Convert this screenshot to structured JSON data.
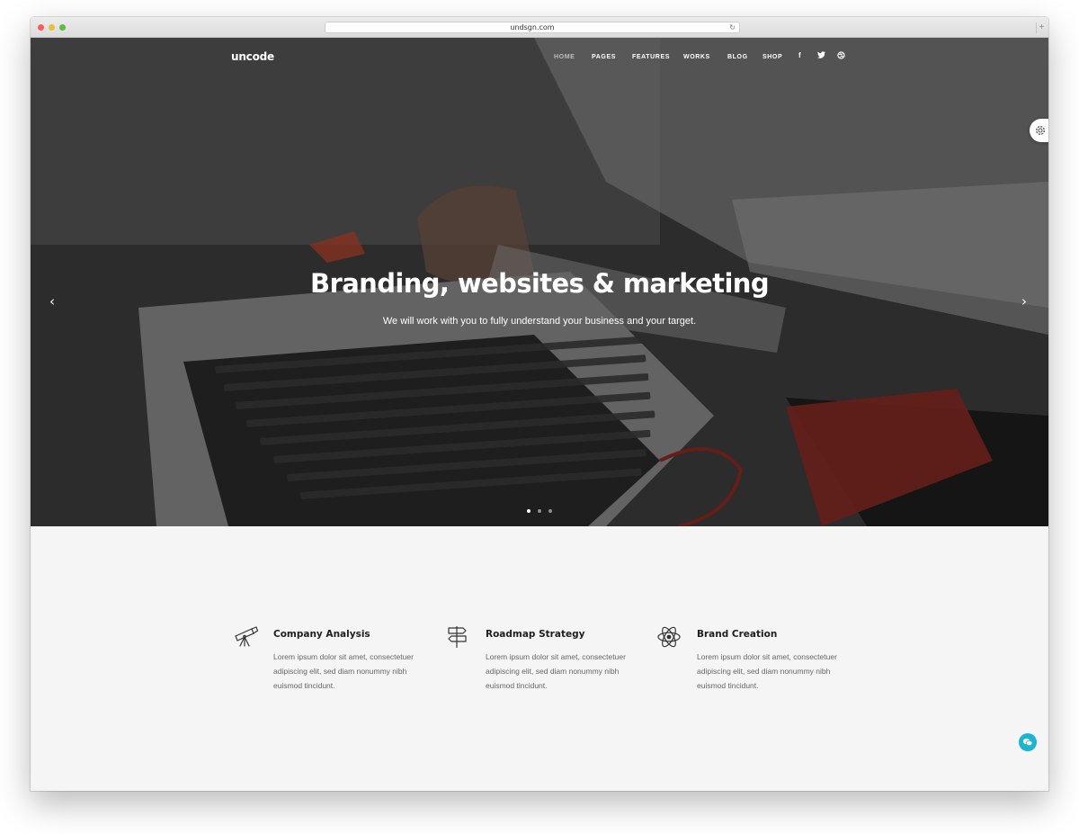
{
  "browser": {
    "url": "undsgn.com",
    "reload_icon": "reload-icon",
    "new_tab_icon": "plus-icon"
  },
  "header": {
    "logo": "uncode",
    "nav": [
      "HOME",
      "PAGES",
      "FEATURES",
      "WORKS",
      "BLOG",
      "SHOP"
    ],
    "active_nav": "HOME",
    "social_icons": [
      "facebook-icon",
      "twitter-icon",
      "dribbble-icon"
    ]
  },
  "hero": {
    "title": "Branding, websites & marketing",
    "subtitle": "We will work with you to fully understand your business and your target.",
    "slide_count": 3,
    "active_slide": 1
  },
  "features": [
    {
      "icon": "telescope-icon",
      "title": "Company Analysis",
      "text": "Lorem ipsum dolor sit amet, consectetuer adipiscing elit, sed diam nonummy nibh euismod tincidunt."
    },
    {
      "icon": "signpost-icon",
      "title": "Roadmap Strategy",
      "text": "Lorem ipsum dolor sit amet, consectetuer adipiscing elit, sed diam nonummy nibh euismod tincidunt."
    },
    {
      "icon": "atom-icon",
      "title": "Brand Creation",
      "text": "Lorem ipsum dolor sit amet, consectetuer adipiscing elit, sed diam nonummy nibh euismod tincidunt."
    }
  ],
  "colors": {
    "accent": "#1cb4d3",
    "background": "#f5f5f5",
    "heading": "#1e1e1e",
    "body_text": "#666666"
  }
}
